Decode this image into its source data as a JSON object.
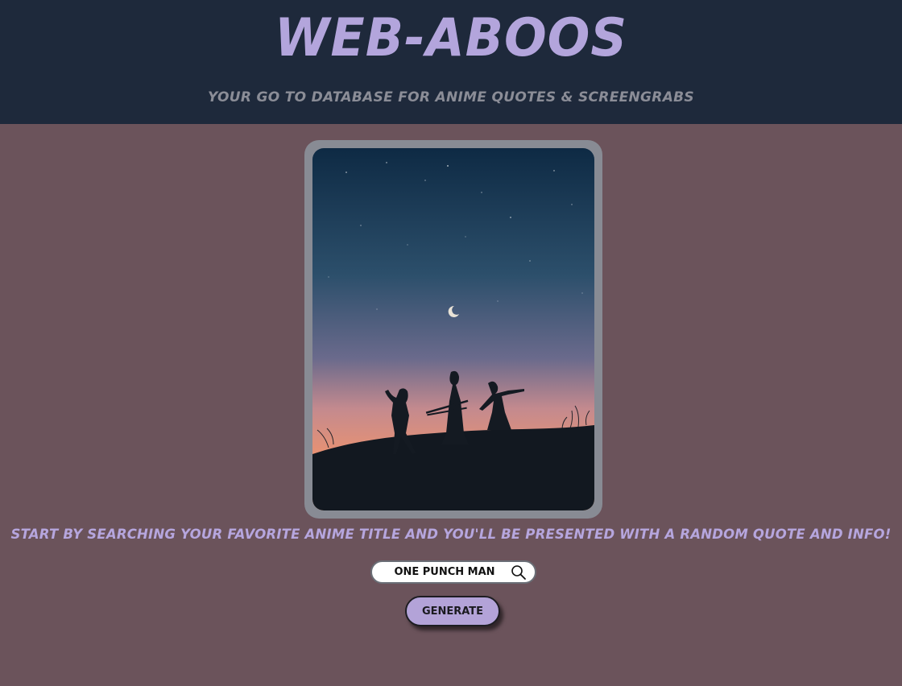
{
  "header": {
    "title": "WEB-ABOOS",
    "tagline": "YOUR GO TO DATABASE FOR ANIME QUOTES & SCREENGRABS"
  },
  "hero_image": {
    "description_icon": "anime-silhouette-sunset-image"
  },
  "intro": {
    "text": "START BY SEARCHING YOUR FAVORITE ANIME TITLE AND YOU'LL BE PRESENTED WITH A RANDOM QUOTE AND INFO!"
  },
  "search": {
    "value": "ONE PUNCH MAN",
    "icon": "search-icon"
  },
  "generate": {
    "label": "GENERATE"
  },
  "colors": {
    "page_bg": "#6b535b",
    "header_bg": "#1e293b",
    "accent": "#b3a5dc",
    "muted": "#8b8d97"
  }
}
